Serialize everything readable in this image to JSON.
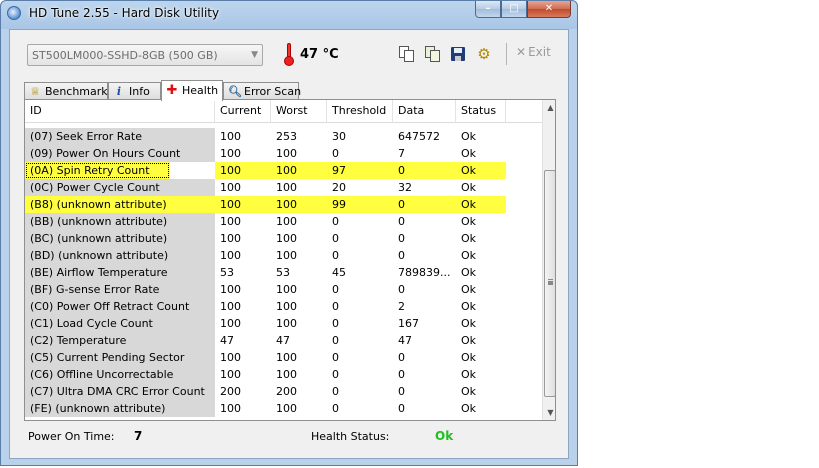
{
  "window": {
    "title": "HD Tune 2.55 - Hard Disk Utility"
  },
  "toolbar": {
    "drive": "ST500LM000-SSHD-8GB (500 GB)",
    "temperature": "47 °C",
    "exit_label": "Exit"
  },
  "tabs": [
    {
      "label": "Benchmark",
      "icon": "benchmark-icon"
    },
    {
      "label": "Info",
      "icon": "info-icon"
    },
    {
      "label": "Health",
      "icon": "health-icon",
      "active": true
    },
    {
      "label": "Error Scan",
      "icon": "error-scan-icon"
    }
  ],
  "table": {
    "columns": [
      "ID",
      "Current",
      "Worst",
      "Threshold",
      "Data",
      "Status"
    ],
    "rows": [
      {
        "id": "(07) Seek Error Rate",
        "current": "100",
        "worst": "253",
        "threshold": "30",
        "data": "647572",
        "status": "Ok",
        "highlight": false
      },
      {
        "id": "(09) Power On Hours Count",
        "current": "100",
        "worst": "100",
        "threshold": "0",
        "data": "7",
        "status": "Ok",
        "highlight": false
      },
      {
        "id": "(0A) Spin Retry Count",
        "current": "100",
        "worst": "100",
        "threshold": "97",
        "data": "0",
        "status": "Ok",
        "highlight": true,
        "focused": true
      },
      {
        "id": "(0C) Power Cycle Count",
        "current": "100",
        "worst": "100",
        "threshold": "20",
        "data": "32",
        "status": "Ok",
        "highlight": false
      },
      {
        "id": "(B8) (unknown attribute)",
        "current": "100",
        "worst": "100",
        "threshold": "99",
        "data": "0",
        "status": "Ok",
        "highlight": true
      },
      {
        "id": "(BB) (unknown attribute)",
        "current": "100",
        "worst": "100",
        "threshold": "0",
        "data": "0",
        "status": "Ok",
        "highlight": false
      },
      {
        "id": "(BC) (unknown attribute)",
        "current": "100",
        "worst": "100",
        "threshold": "0",
        "data": "0",
        "status": "Ok",
        "highlight": false
      },
      {
        "id": "(BD) (unknown attribute)",
        "current": "100",
        "worst": "100",
        "threshold": "0",
        "data": "0",
        "status": "Ok",
        "highlight": false
      },
      {
        "id": "(BE) Airflow Temperature",
        "current": "53",
        "worst": "53",
        "threshold": "45",
        "data": "789839...",
        "status": "Ok",
        "highlight": false
      },
      {
        "id": "(BF) G-sense Error Rate",
        "current": "100",
        "worst": "100",
        "threshold": "0",
        "data": "0",
        "status": "Ok",
        "highlight": false
      },
      {
        "id": "(C0) Power Off Retract Count",
        "current": "100",
        "worst": "100",
        "threshold": "0",
        "data": "2",
        "status": "Ok",
        "highlight": false
      },
      {
        "id": "(C1) Load Cycle Count",
        "current": "100",
        "worst": "100",
        "threshold": "0",
        "data": "167",
        "status": "Ok",
        "highlight": false
      },
      {
        "id": "(C2) Temperature",
        "current": "47",
        "worst": "47",
        "threshold": "0",
        "data": "47",
        "status": "Ok",
        "highlight": false
      },
      {
        "id": "(C5) Current Pending Sector",
        "current": "100",
        "worst": "100",
        "threshold": "0",
        "data": "0",
        "status": "Ok",
        "highlight": false
      },
      {
        "id": "(C6) Offline Uncorrectable",
        "current": "100",
        "worst": "100",
        "threshold": "0",
        "data": "0",
        "status": "Ok",
        "highlight": false
      },
      {
        "id": "(C7) Ultra DMA CRC Error Count",
        "current": "200",
        "worst": "200",
        "threshold": "0",
        "data": "0",
        "status": "Ok",
        "highlight": false
      },
      {
        "id": "(FE) (unknown attribute)",
        "current": "100",
        "worst": "100",
        "threshold": "0",
        "data": "0",
        "status": "Ok",
        "highlight": false
      }
    ]
  },
  "status": {
    "power_on_label": "Power On Time:",
    "power_on_value": "7",
    "health_label": "Health Status:",
    "health_value": "Ok"
  },
  "colors": {
    "highlight": "#ffff40",
    "ok_green": "#1fbf1f"
  }
}
